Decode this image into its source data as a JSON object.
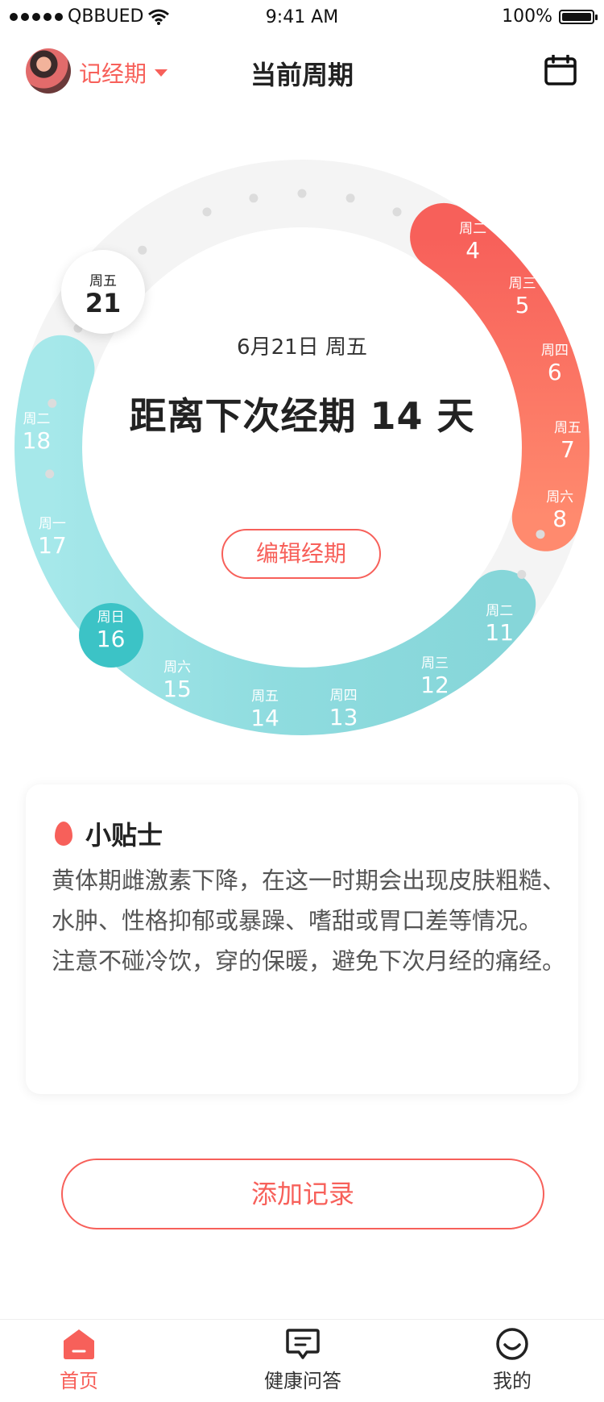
{
  "status_bar": {
    "carrier": "QBBUED",
    "time": "9:41 AM",
    "battery": "100%"
  },
  "nav": {
    "record_label": "记经期",
    "title": "当前周期",
    "calendar_icon": "calendar-icon"
  },
  "cycle": {
    "selected": {
      "weekday": "周五",
      "day": "21"
    },
    "center_date": "6月21日  周五",
    "next_period_text": "距离下次经期 14 天",
    "edit_button": "编辑经期",
    "period_days": [
      {
        "weekday": "周二",
        "day": "4"
      },
      {
        "weekday": "周三",
        "day": "5"
      },
      {
        "weekday": "周四",
        "day": "6"
      },
      {
        "weekday": "周五",
        "day": "7"
      },
      {
        "weekday": "周六",
        "day": "8"
      }
    ],
    "fertile_days": [
      {
        "weekday": "周二",
        "day": "11"
      },
      {
        "weekday": "周三",
        "day": "12"
      },
      {
        "weekday": "周四",
        "day": "13"
      },
      {
        "weekday": "周五",
        "day": "14"
      },
      {
        "weekday": "周六",
        "day": "15"
      },
      {
        "weekday": "周日",
        "day": "16"
      },
      {
        "weekday": "周一",
        "day": "17"
      },
      {
        "weekday": "周二",
        "day": "18"
      }
    ],
    "colors": {
      "period": "#f7605a",
      "period_end": "#ff8a6e",
      "fertile": "#8fdcdf",
      "ovulation": "#3cc3c6",
      "track": "#f4f4f4"
    }
  },
  "tips": {
    "title": "小贴士",
    "paragraph1": "黄体期雌激素下降，在这一时期会出现皮肤粗糙、水肿、性格抑郁或暴躁、嗜甜或胃口差等情况。",
    "paragraph2": "注意不碰冷饮，穿的保暖，避免下次月经的痛经。"
  },
  "add_button": "添加记录",
  "tabbar": {
    "items": [
      {
        "label": "首页",
        "icon": "home-icon",
        "active": true
      },
      {
        "label": "健康问答",
        "icon": "chat-icon",
        "active": false
      },
      {
        "label": "我的",
        "icon": "profile-icon",
        "active": false
      }
    ]
  }
}
